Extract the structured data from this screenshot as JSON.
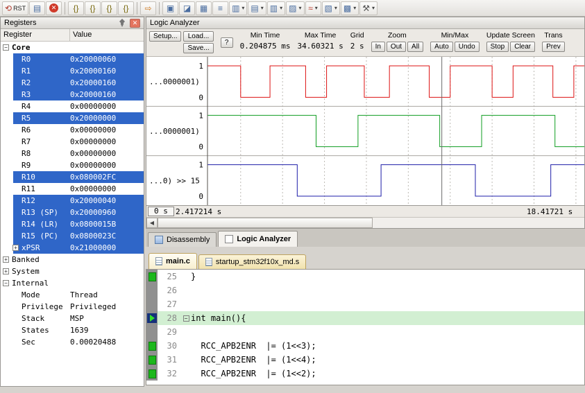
{
  "toolbar": {
    "items": [
      {
        "name": "reset",
        "glyph": "⟲",
        "label": "RST",
        "color": "#b03a2e"
      },
      {
        "name": "source-window",
        "glyph": "▤",
        "color": "#4a6da0"
      },
      {
        "name": "kill-all",
        "glyph": "✕",
        "color": "#ffffff",
        "bg": "#d03a2a"
      },
      {
        "sep": true
      },
      {
        "name": "step-into",
        "glyph": "{}",
        "color": "#7a6a10"
      },
      {
        "name": "step-over",
        "glyph": "{}",
        "color": "#7a6a10"
      },
      {
        "name": "step-out",
        "glyph": "{}",
        "color": "#7a6a10"
      },
      {
        "name": "run-to-cursor",
        "glyph": "{}",
        "color": "#7a6a10"
      },
      {
        "sep": true
      },
      {
        "name": "show-next-statement",
        "glyph": "⇨",
        "color": "#d07a20"
      },
      {
        "sep": true
      },
      {
        "name": "command-window",
        "glyph": "▣",
        "color": "#4a6da0"
      },
      {
        "name": "disassembly-window",
        "glyph": "◪",
        "color": "#4a6da0"
      },
      {
        "name": "symbol-window",
        "glyph": "▦",
        "color": "#4a6da0"
      },
      {
        "name": "registers-window",
        "glyph": "≡",
        "color": "#4a6da0"
      },
      {
        "name": "call-stack-window",
        "glyph": "▥",
        "color": "#4a6da0",
        "dd": true
      },
      {
        "name": "watch-window",
        "glyph": "▤",
        "color": "#4a6da0",
        "dd": true
      },
      {
        "name": "memory-window",
        "glyph": "▥",
        "color": "#4a6da0",
        "dd": true
      },
      {
        "name": "serial-window",
        "glyph": "▨",
        "color": "#4a6da0",
        "dd": true
      },
      {
        "name": "analysis-window",
        "glyph": "≈",
        "color": "#c0392b",
        "dd": true
      },
      {
        "name": "trace-window",
        "glyph": "▧",
        "color": "#4a6da0",
        "dd": true
      },
      {
        "name": "system-viewer",
        "glyph": "▩",
        "color": "#4a6da0",
        "dd": true
      },
      {
        "name": "debug-toolbox",
        "glyph": "⚒",
        "color": "#555555",
        "dd": true
      }
    ]
  },
  "registers_panel": {
    "title": "Registers",
    "columns": [
      "Register",
      "Value"
    ],
    "rows": [
      {
        "name": "Core",
        "value": "",
        "level": 0,
        "bold": true,
        "expander": "-"
      },
      {
        "name": "R0",
        "value": "0x20000060",
        "level": 1,
        "selected": true
      },
      {
        "name": "R1",
        "value": "0x20000160",
        "level": 1,
        "selected": true
      },
      {
        "name": "R2",
        "value": "0x20000160",
        "level": 1,
        "selected": true
      },
      {
        "name": "R3",
        "value": "0x20000160",
        "level": 1,
        "selected": true
      },
      {
        "name": "R4",
        "value": "0x00000000",
        "level": 1
      },
      {
        "name": "R5",
        "value": "0x20000000",
        "level": 1,
        "selected": true
      },
      {
        "name": "R6",
        "value": "0x00000000",
        "level": 1
      },
      {
        "name": "R7",
        "value": "0x00000000",
        "level": 1
      },
      {
        "name": "R8",
        "value": "0x00000000",
        "level": 1
      },
      {
        "name": "R9",
        "value": "0x00000000",
        "level": 1
      },
      {
        "name": "R10",
        "value": "0x080002FC",
        "level": 1,
        "selected": true
      },
      {
        "name": "R11",
        "value": "0x00000000",
        "level": 1
      },
      {
        "name": "R12",
        "value": "0x20000040",
        "level": 1,
        "selected": true
      },
      {
        "name": "R13 (SP)",
        "value": "0x20000960",
        "level": 1,
        "selected": true
      },
      {
        "name": "R14 (LR)",
        "value": "0x0800015B",
        "level": 1,
        "selected": true
      },
      {
        "name": "R15 (PC)",
        "value": "0x0800023C",
        "level": 1,
        "selected": true
      },
      {
        "name": "xPSR",
        "value": "0x21000000",
        "level": 1,
        "selected": true,
        "expander": "+"
      },
      {
        "name": "Banked",
        "value": "",
        "level": 0,
        "expander": "+"
      },
      {
        "name": "System",
        "value": "",
        "level": 0,
        "expander": "+"
      },
      {
        "name": "Internal",
        "value": "",
        "level": 0,
        "expander": "-"
      },
      {
        "name": "Mode",
        "value": "Thread",
        "level": 1
      },
      {
        "name": "Privilege",
        "value": "Privileged",
        "level": 1
      },
      {
        "name": "Stack",
        "value": "MSP",
        "level": 1
      },
      {
        "name": "States",
        "value": "1639",
        "level": 1
      },
      {
        "name": "Sec",
        "value": "0.00020488",
        "level": 1
      }
    ]
  },
  "logic_analyzer": {
    "title": "Logic Analyzer",
    "controls": {
      "setup": "Setup...",
      "load": "Load...",
      "save": "Save...",
      "help": "?",
      "min_time_label": "Min Time",
      "min_time": "0.204875 ms",
      "max_time_label": "Max Time",
      "max_time": "34.60321 s",
      "grid_label": "Grid",
      "grid": "2 s",
      "zoom_label": "Zoom",
      "zoom_buttons": [
        "In",
        "Out",
        "All"
      ],
      "minmax_label": "Min/Max",
      "minmax_buttons": [
        "Auto",
        "Undo"
      ],
      "update_label": "Update Screen",
      "update_buttons": [
        "Stop",
        "Clear"
      ],
      "trans_label": "Trans",
      "trans_buttons": [
        "Prev"
      ]
    },
    "timeline": {
      "start_label": "0 s",
      "left_time": "2.417214 s",
      "right_time": "18.41721 s"
    },
    "chart_data": {
      "type": "line",
      "subtype": "digital-waveform",
      "time_range_s": [
        2.417214,
        20.4
      ],
      "grid_spacing_s": 2,
      "cursor_time_s": 13.6,
      "scale_labels": {
        "high": "1",
        "low": "0"
      },
      "signals": [
        {
          "label": "...0000001)",
          "color": "#dd1111",
          "initial": 1,
          "toggle_times_s": [
            4.0,
            5.4,
            7.1,
            8.1,
            9.9,
            11.1,
            13.0,
            14.0,
            16.0,
            17.0,
            18.9,
            19.9
          ]
        },
        {
          "label": "...0000001)",
          "color": "#0f9d20",
          "initial": 1,
          "toggle_times_s": [
            7.6,
            9.6,
            13.5,
            15.5,
            19.0
          ]
        },
        {
          "label": "...0) >> 15",
          "color": "#1c1ca8",
          "initial": 1,
          "toggle_times_s": [
            6.7,
            10.7,
            15.2,
            18.8
          ]
        }
      ]
    }
  },
  "dock_tabs": [
    {
      "label": "Disassembly",
      "icon": "disasm"
    },
    {
      "label": "Logic Analyzer",
      "icon": "la",
      "active": true
    }
  ],
  "editor": {
    "tabs": [
      {
        "label": "main.c",
        "active": true
      },
      {
        "label": "startup_stm32f10x_md.s"
      }
    ],
    "lines": [
      {
        "num": 25,
        "text": "}",
        "block": true
      },
      {
        "num": 26,
        "text": ""
      },
      {
        "num": 27,
        "text": ""
      },
      {
        "num": 28,
        "text": "int main(){",
        "current": true,
        "fold": "-"
      },
      {
        "num": 29,
        "text": ""
      },
      {
        "num": 30,
        "text": "  RCC_APB2ENR  |= (1<<3);",
        "block": true
      },
      {
        "num": 31,
        "text": "  RCC_APB2ENR  |= (1<<4);",
        "block": true
      },
      {
        "num": 32,
        "text": "  RCC_APB2ENR  |= (1<<2);",
        "block": true
      }
    ]
  }
}
